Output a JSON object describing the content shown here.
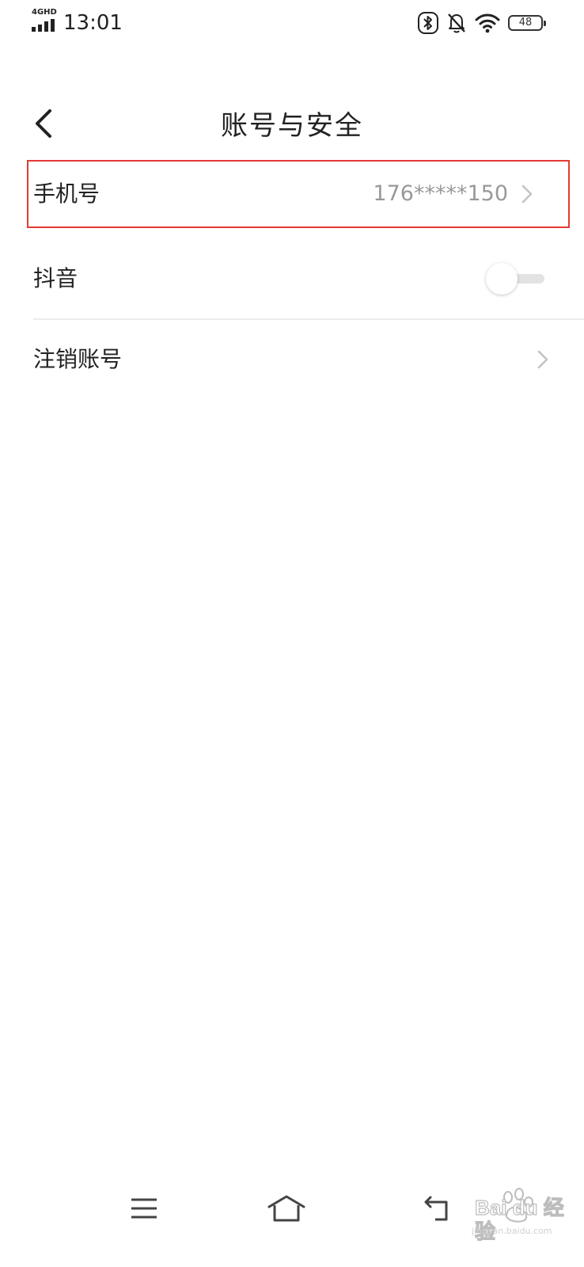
{
  "status_bar": {
    "network": "4GHD",
    "time": "13:01",
    "battery": "48"
  },
  "header": {
    "title": "账号与安全",
    "back_icon": "chevron-left-icon"
  },
  "settings": {
    "phone": {
      "label": "手机号",
      "value": "176*****150"
    },
    "douyin": {
      "label": "抖音",
      "toggle_on": false
    },
    "deactivate": {
      "label": "注销账号"
    }
  },
  "nav_bar": {
    "menu_icon": "menu-icon",
    "home_icon": "home-icon",
    "back_icon": "back-icon"
  },
  "watermark": {
    "brand": "Bai du",
    "product": "经验",
    "url": "jingyan.baidu.com"
  },
  "colors": {
    "highlight_border": "#e53935",
    "secondary_text": "#999999",
    "chevron": "#c4c4c4",
    "divider": "#ececec"
  }
}
